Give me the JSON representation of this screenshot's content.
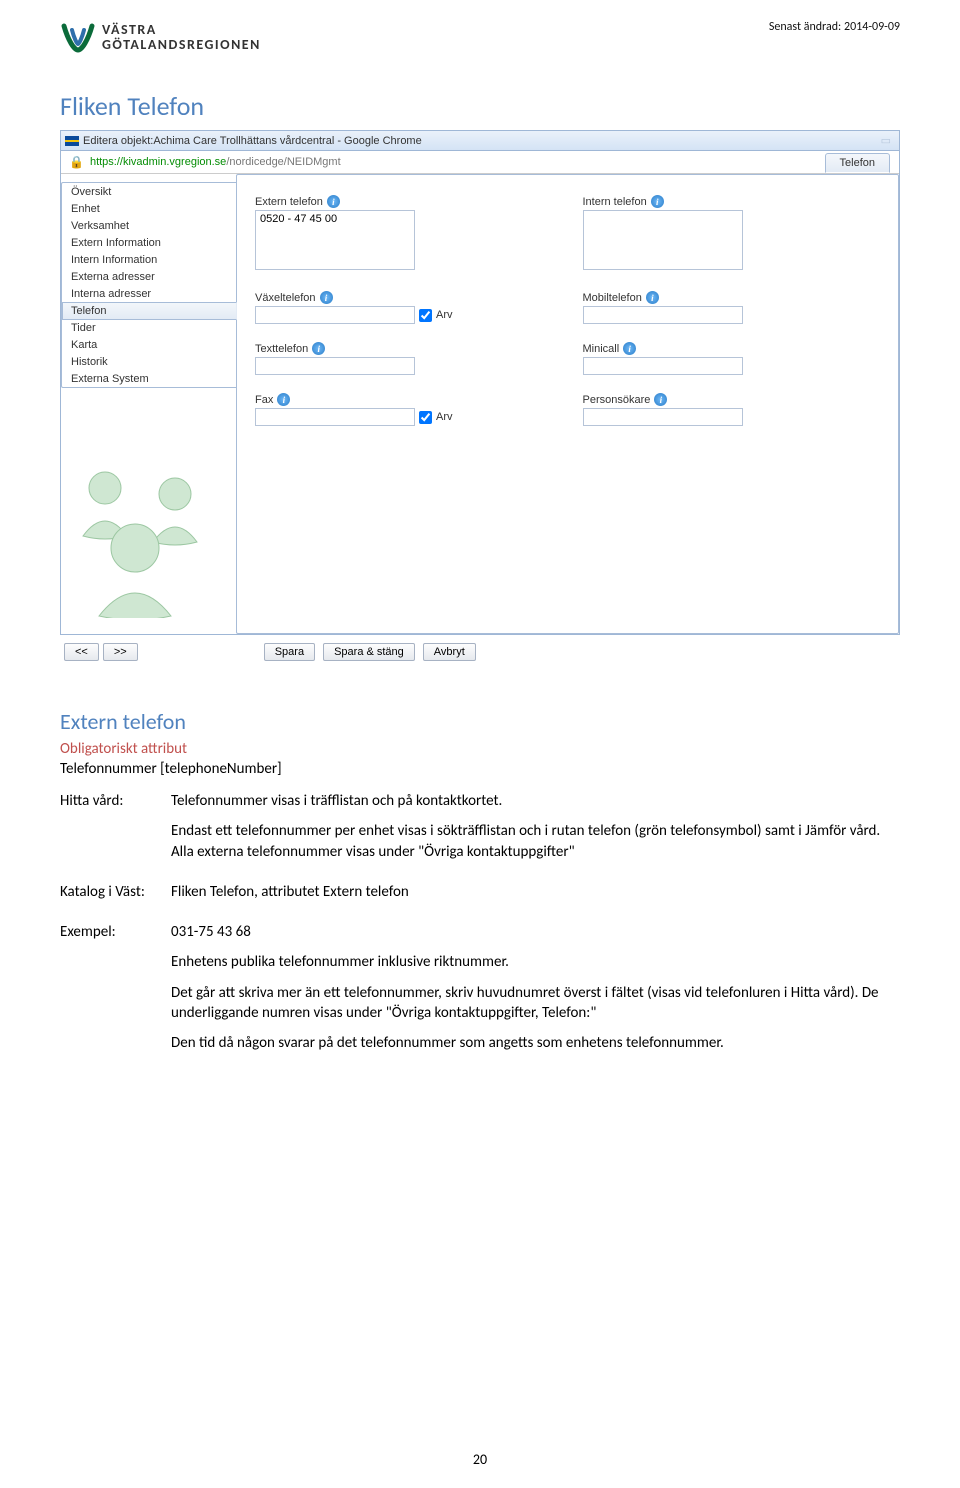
{
  "header": {
    "org_line1": "VÄSTRA",
    "org_line2": "GÖTALANDSREGIONEN",
    "last_modified_label": "Senast ändrad:",
    "last_modified_value": "2014-09-09"
  },
  "section_title": "Fliken Telefon",
  "browser": {
    "window_title": "Editera objekt:Achima Care Trollhättans vårdcentral - Google Chrome",
    "address_host": "https://kivadmin.vgregion.se",
    "address_path": "/nordicedge/NEIDMgmt"
  },
  "sidebar": {
    "items": [
      "Översikt",
      "Enhet",
      "Verksamhet",
      "Extern Information",
      "Intern Information",
      "Externa adresser",
      "Interna adresser",
      "Telefon",
      "Tider",
      "Karta",
      "Historik",
      "Externa System"
    ],
    "active_index": 7
  },
  "tab_label": "Telefon",
  "fields": {
    "extern_label": "Extern telefon",
    "extern_value": "0520 - 47 45 00",
    "intern_label": "Intern telefon",
    "vaxel_label": "Växeltelefon",
    "mobil_label": "Mobiltelefon",
    "text_label": "Texttelefon",
    "minicall_label": "Minicall",
    "fax_label": "Fax",
    "personsokare_label": "Personsökare",
    "arv_label": "Arv"
  },
  "buttons": {
    "prev": "<<",
    "next": ">>",
    "spara": "Spara",
    "spara_stang": "Spara & stäng",
    "avbryt": "Avbryt"
  },
  "doc": {
    "heading": "Extern telefon",
    "obligatory": "Obligatoriskt attribut",
    "attr_line": "Telefonnummer [telephoneNumber]",
    "hitta_label": "Hitta vård:",
    "hitta_p1": "Telefonnummer visas i träfflistan och på kontaktkortet.",
    "hitta_p2": "Endast ett telefonnummer per enhet visas i sökträfflistan och i rutan telefon (grön telefonsymbol) samt i Jämför vård. Alla externa telefonnummer visas under \"Övriga kontaktuppgifter\"",
    "katalog_label": "Katalog i Väst:",
    "katalog_val": "Fliken Telefon, attributet Extern telefon",
    "exempel_label": "Exempel:",
    "exempel_num": "031-75 43 68",
    "exempel_p1": "Enhetens publika telefonnummer inklusive riktnummer.",
    "exempel_p2": "Det går att skriva mer än ett telefonnummer, skriv huvudnumret överst i fältet (visas vid telefonluren i Hitta vård). De underliggande numren visas under \"Övriga kontaktuppgifter, Telefon:\"",
    "exempel_p3": "Den tid då någon svarar på det telefonnummer som angetts som enhetens telefonnummer."
  },
  "page_number": "20"
}
